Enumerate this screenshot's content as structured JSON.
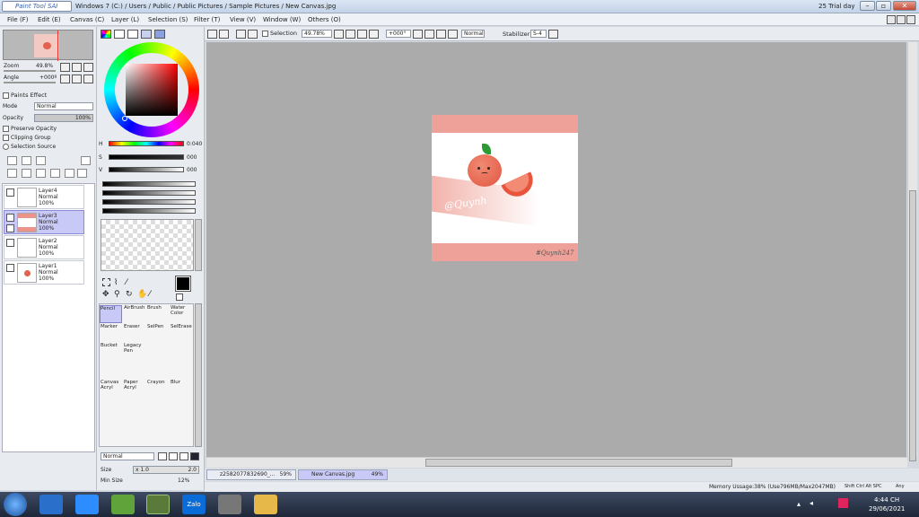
{
  "window": {
    "app_logo": "Paint Tool SAI",
    "title": "Windows 7 (C:) / Users / Public / Public Pictures / Sample Pictures / New Canvas.jpg",
    "trial": "25 Trial day"
  },
  "menus": [
    "File (F)",
    "Edit (E)",
    "Canvas (C)",
    "Layer (L)",
    "Selection (S)",
    "Filter (T)",
    "View (V)",
    "Window (W)",
    "Others (O)"
  ],
  "navigator": {
    "zoom_label": "Zoom",
    "zoom_value": "49.8%",
    "angle_label": "Angle",
    "angle_value": "+000º"
  },
  "layer_props": {
    "paints_effect": "Paints Effect",
    "mode_label": "Mode",
    "mode_value": "Normal",
    "opacity_label": "Opacity",
    "opacity_value": "100%",
    "preserve_opacity": "Preserve Opacity",
    "clipping_group": "Clipping Group",
    "selection_source": "Selection Source"
  },
  "layers": [
    {
      "name": "Layer4",
      "mode": "Normal",
      "opacity": "100%"
    },
    {
      "name": "Layer3",
      "mode": "Normal",
      "opacity": "100%"
    },
    {
      "name": "Layer2",
      "mode": "Normal",
      "opacity": "100%"
    },
    {
      "name": "Layer1",
      "mode": "Normal",
      "opacity": "100%"
    }
  ],
  "color": {
    "h_label": "H",
    "h_value": "0:040",
    "s_label": "S",
    "s_value": "000",
    "v_label": "V",
    "v_value": "000",
    "current": "#000000"
  },
  "tools": [
    {
      "name": "Pencil"
    },
    {
      "name": "AirBrush"
    },
    {
      "name": "Brush"
    },
    {
      "name": "Water Color"
    },
    {
      "name": "Marker"
    },
    {
      "name": "Eraser"
    },
    {
      "name": "SelPen"
    },
    {
      "name": "SelErase"
    },
    {
      "name": "Bucket"
    },
    {
      "name": "Legacy Pen"
    },
    {
      "name": "Canvas Acryl"
    },
    {
      "name": "Paper Acryl"
    },
    {
      "name": "Crayon"
    },
    {
      "name": "Blur"
    }
  ],
  "brush": {
    "mode_value": "Normal",
    "size_label": "Size",
    "size_mult": "x 1.0",
    "size_value": "2.0",
    "min_size_label": "Min Size",
    "min_size_value": "12%"
  },
  "toolbar": {
    "selection_label": "Selection",
    "zoom": "49.78%",
    "angle": "+000°",
    "blend": "Normal",
    "stabilizer_label": "Stabilizer",
    "stabilizer_value": "S-4"
  },
  "artwork": {
    "signature": "@Quynh",
    "corner_sig": "#Quynh247"
  },
  "doc_tabs": [
    {
      "label": "z2582077832690_...",
      "zoom": "59%"
    },
    {
      "label": "New Canvas.jpg",
      "zoom": "49%"
    }
  ],
  "status": {
    "memory": "Memory Ussage:38% (Use796MB/Max2047MB)",
    "keys": "Shift Ctrl Alt SPC",
    "any": "Any"
  },
  "taskbar": {
    "app_zalo": "Zalo",
    "time": "4:44 CH",
    "date": "29/06/2021"
  }
}
